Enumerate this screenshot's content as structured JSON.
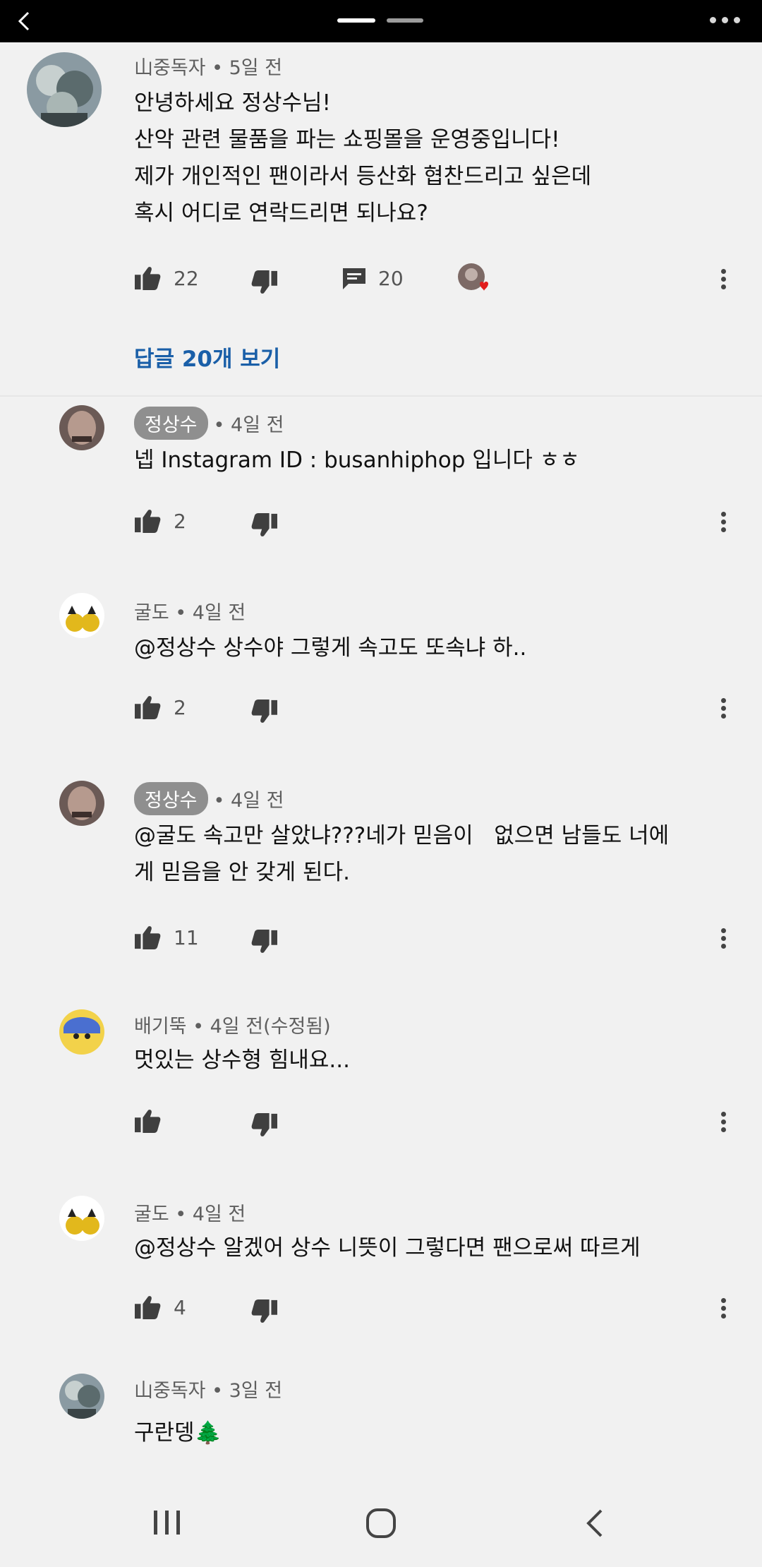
{
  "reply_link": "답글 20개 보기",
  "icons": {
    "like": "thumbs-up-icon",
    "dislike": "thumbs-down-icon",
    "reply": "reply-icon",
    "heart": "creator-heart-icon",
    "menu": "more-vertical-icon",
    "tree_emoji": "🌲"
  },
  "comments": [
    {
      "author": "山중독자",
      "time": "• 5일 전",
      "lines": [
        "안녕하세요 정상수님!",
        "산악 관련 물품을 파는 쇼핑몰을 운영중입니다!",
        "제가 개인적인 팬이라서 등산화 협찬드리고 싶은데",
        "혹시 어디로 연락드리면 되나요?"
      ],
      "likes": "22",
      "replies": "20"
    },
    {
      "author": "정상수",
      "time": "• 4일 전",
      "lines": [
        "넵 Instagram ID : busanhiphop 입니다 ㅎㅎ"
      ],
      "likes": "2"
    },
    {
      "author": "굴도",
      "time": "• 4일 전",
      "lines": [
        "@정상수 상수야 그렇게 속고도 또속냐 하.."
      ],
      "likes": "2"
    },
    {
      "author": "정상수",
      "time": "• 4일 전",
      "lines": [
        "@굴도 속고만 살았냐???네가 믿음이   없으면 남들도 너에",
        "게 믿음을 안 갖게 된다."
      ],
      "likes": "11"
    },
    {
      "author": "배기뚝",
      "time": "• 4일 전(수정됨)",
      "lines": [
        "멋있는 상수형 힘내요..."
      ],
      "likes": ""
    },
    {
      "author": "굴도",
      "time": "• 4일 전",
      "lines": [
        "@정상수 알겠어 상수 니뜻이 그렇다면 팬으로써 따르게"
      ],
      "likes": "4"
    },
    {
      "author": "山중독자",
      "time": "• 3일 전",
      "lines": [
        "구란뎅"
      ]
    }
  ]
}
